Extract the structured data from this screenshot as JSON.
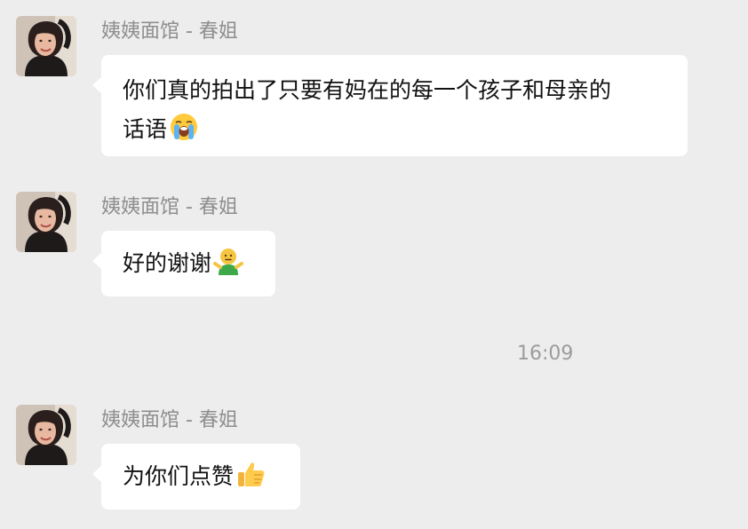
{
  "messages": [
    {
      "sender": "姨姨面馆 - 春姐",
      "text": "你们真的拍出了只要有妈在的每一个孩子和母亲的话语",
      "text_line1": "你们真的拍出了只要有妈在的每一个孩子和母亲的",
      "text_line2": "话语",
      "emoji": "loudly-crying-face-icon"
    },
    {
      "sender": "姨姨面馆 - 春姐",
      "text": "好的谢谢",
      "emoji": "shrugging-person-icon"
    },
    {
      "sender": "姨姨面馆 - 春姐",
      "text": "为你们点赞",
      "emoji": "thumbs-up-icon"
    }
  ],
  "timestamp": "16:09",
  "colors": {
    "background": "#ededed",
    "bubble": "#ffffff",
    "sender_text": "#8e8e8e",
    "timestamp_text": "#9c9c9c",
    "message_text": "#111111"
  }
}
